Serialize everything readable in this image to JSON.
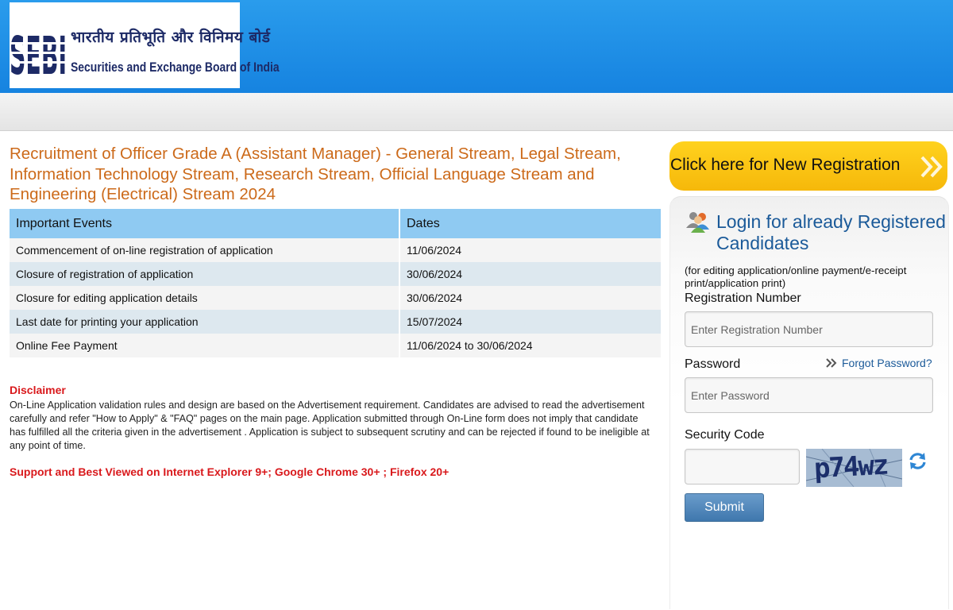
{
  "header": {
    "logo_hindi": "भारतीय प्रतिभूति और विनिमय बोर्ड",
    "logo_english": "Securities and Exchange Board of India",
    "bg_color": "#1683e0"
  },
  "main": {
    "title": "Recruitment of Officer Grade A (Assistant Manager) - General Stream, Legal Stream, Information Technology Stream, Research Stream, Official Language Stream and Engineering (Electrical) Stream 2024",
    "table": {
      "headers": [
        "Important Events",
        "Dates"
      ],
      "rows": [
        [
          "Commencement of on-line registration of application",
          "11/06/2024"
        ],
        [
          "Closure of registration of application",
          "30/06/2024"
        ],
        [
          "Closure for editing application details",
          "30/06/2024"
        ],
        [
          "Last date for printing your application",
          "15/07/2024"
        ],
        [
          "Online Fee Payment",
          "11/06/2024 to 30/06/2024"
        ]
      ]
    },
    "disclaimer_title": "Disclaimer",
    "disclaimer_text": "On-Line Application validation rules and design are based on the Advertisement requirement. Candidates are advised to read the advertisement carefully and refer \"How to Apply\" & \"FAQ\" pages on the main page. Application submitted through On-Line form does not imply that candidate has fulfilled all the criteria given in the advertisement . Application is subject to subsequent scrutiny and can be rejected if found to be ineligible at any point of time.",
    "support_text": "Support and Best Viewed on Internet Explorer 9+; Google Chrome 30+ ; Firefox 20+"
  },
  "sidebar": {
    "new_registration_label": "Click here for New Registration",
    "login_title": "Login for already Registered Candidates",
    "login_subtitle": "(for editing application/online payment/e-receipt print/application print)",
    "registration_label": "Registration Number",
    "registration_placeholder": "Enter Registration Number",
    "password_label": "Password",
    "forgot_password": "Forgot Password?",
    "password_placeholder": "Enter Password",
    "security_code_label": "Security Code",
    "captcha_text": "p74wz",
    "submit_label": "Submit"
  }
}
